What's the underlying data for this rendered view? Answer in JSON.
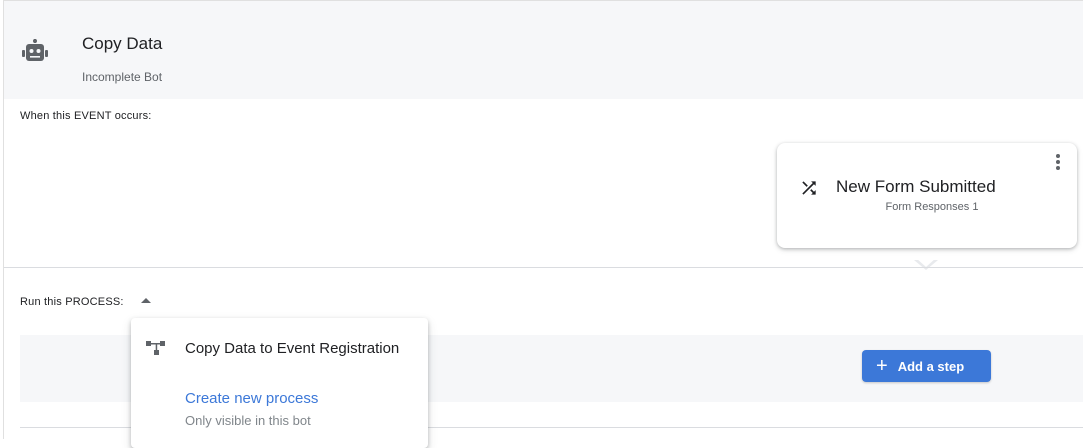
{
  "header": {
    "title": "Copy Data",
    "subtitle": "Incomplete Bot",
    "icon": "robot-icon"
  },
  "event_section": {
    "label": "When this EVENT occurs:",
    "card": {
      "title": "New Form Submitted",
      "subtitle": "Form Responses 1",
      "icon": "shuffle-icon",
      "menu_icon": "more-vert-icon"
    }
  },
  "process_section": {
    "label": "Run this PROCESS:",
    "add_step_label": "Add a step",
    "dropdown": {
      "items": [
        {
          "label": "Copy Data to Event Registration",
          "icon": "flow-icon"
        }
      ],
      "create_label": "Create new process",
      "create_sub": "Only visible in this bot"
    }
  },
  "colors": {
    "accent": "#3c78d8",
    "header_bg": "#f6f7f9"
  }
}
